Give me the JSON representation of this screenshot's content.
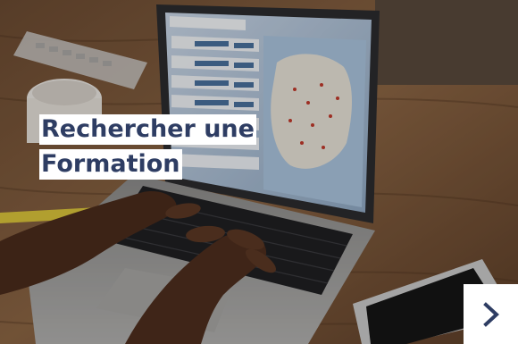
{
  "card": {
    "title_line1": "Rechercher une",
    "title_line2": "Formation"
  },
  "next_button": {
    "icon": "chevron-right-icon"
  },
  "colors": {
    "title_text": "#2e3d63",
    "title_bg": "#ffffff",
    "chevron": "#2e3d63"
  }
}
